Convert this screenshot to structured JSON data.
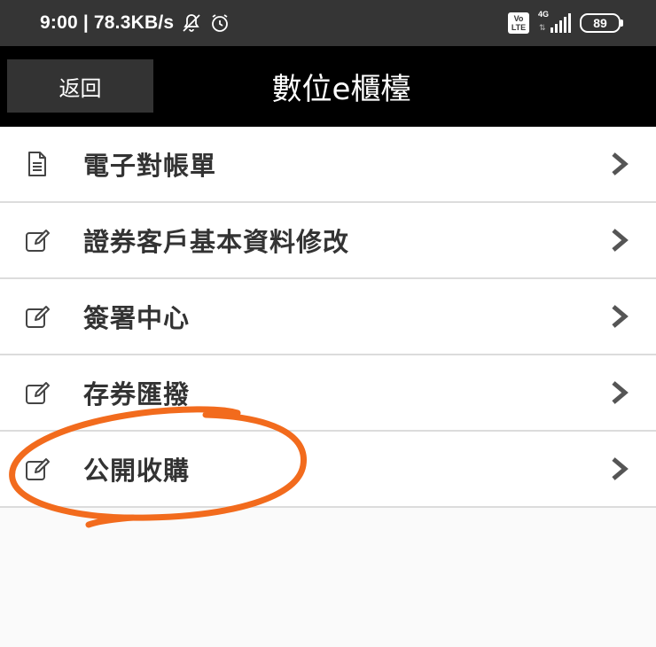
{
  "status_bar": {
    "time": "9:00",
    "separator": "|",
    "speed": "78.3KB/s",
    "volte_top": "Vo",
    "volte_bottom": "LTE",
    "network": "4G",
    "battery": "89",
    "icons": [
      "notifications-off-icon",
      "alarm-icon",
      "volte-icon",
      "signal-icon",
      "battery-icon"
    ]
  },
  "header": {
    "back_label": "返回",
    "title": "數位e櫃檯"
  },
  "menu": {
    "items": [
      {
        "label": "電子對帳單",
        "icon": "document-icon"
      },
      {
        "label": "證券客戶基本資料修改",
        "icon": "edit-icon"
      },
      {
        "label": "簽署中心",
        "icon": "edit-icon"
      },
      {
        "label": "存券匯撥",
        "icon": "edit-icon"
      },
      {
        "label": "公開收購",
        "icon": "edit-icon"
      }
    ],
    "chevron_icon": "chevron-right-icon"
  },
  "annotation": {
    "color": "#f26b1d",
    "target": "公開收購"
  },
  "colors": {
    "status_bar": "#353535",
    "header": "#000000",
    "back_button": "#333333",
    "list_text": "#333333",
    "divider": "#dcdcdc"
  }
}
